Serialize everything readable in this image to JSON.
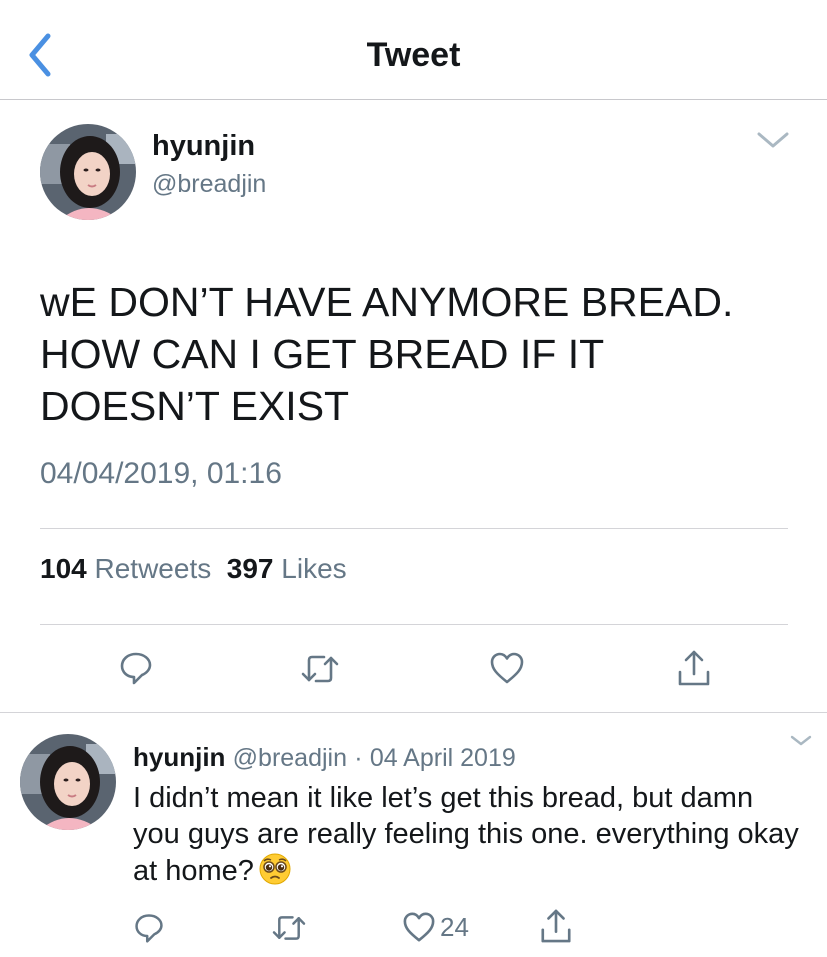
{
  "nav": {
    "title": "Tweet"
  },
  "tweet": {
    "author_name": "hyunjin",
    "author_handle": "@breadjin",
    "text": "wE DON’T HAVE ANYMORE BREAD.\nHOW CAN I GET BREAD IF IT\nDOESN’T EXIST",
    "timestamp": "04/04/2019, 01:16",
    "retweet_count": "104",
    "retweet_label": "Retweets",
    "like_count": "397",
    "like_label": "Likes"
  },
  "reply": {
    "author_name": "hyunjin",
    "author_handle": "@breadjin",
    "separator": "·",
    "date": "04 April 2019",
    "text": "I didn’t mean it like let’s get this bread, but damn you guys are really feeling this one. everything okay at home?",
    "emoji_name": "pleading-face-emoji",
    "like_count": "24"
  },
  "icons": {
    "back": "chevron-left-icon",
    "more": "chevron-down-icon",
    "reply": "reply-icon",
    "retweet": "retweet-icon",
    "like": "heart-icon",
    "share": "share-icon"
  },
  "colors": {
    "accent": "#4a90e2",
    "text": "#14171a",
    "secondary": "#657786",
    "divider": "#d4d4d8"
  }
}
